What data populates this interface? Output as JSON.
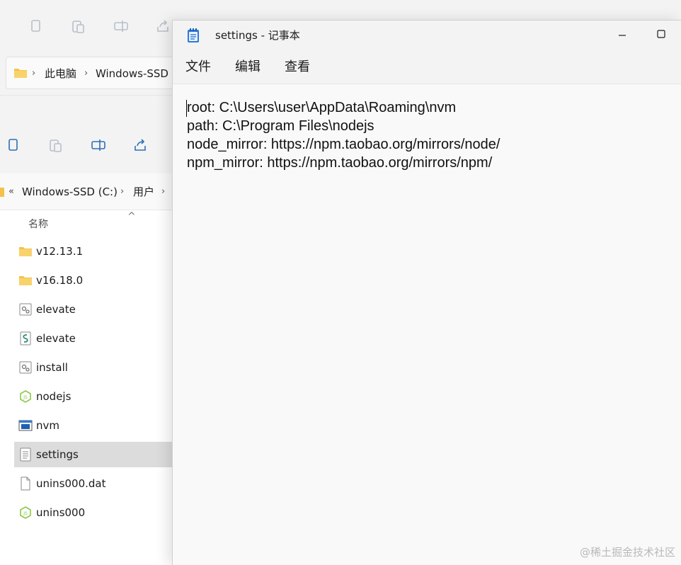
{
  "back_explorer": {
    "breadcrumb": [
      "此电脑",
      "Windows-SSD ("
    ]
  },
  "front_explorer": {
    "breadcrumb_prefix": "«",
    "breadcrumb": [
      "Windows-SSD (C:)",
      "用户"
    ],
    "column_header": "名称",
    "files": [
      {
        "name": "v12.13.1",
        "icon": "folder-icon",
        "selected": false
      },
      {
        "name": "v16.18.0",
        "icon": "folder-icon",
        "selected": false
      },
      {
        "name": "elevate",
        "icon": "cmd-file-icon",
        "selected": false
      },
      {
        "name": "elevate",
        "icon": "script-file-icon",
        "selected": false
      },
      {
        "name": "install",
        "icon": "cmd-file-icon",
        "selected": false
      },
      {
        "name": "nodejs",
        "icon": "nodejs-icon",
        "selected": false
      },
      {
        "name": "nvm",
        "icon": "exe-icon",
        "selected": false
      },
      {
        "name": "settings",
        "icon": "text-file-icon",
        "selected": true
      },
      {
        "name": "unins000.dat",
        "icon": "blank-file-icon",
        "selected": false
      },
      {
        "name": "unins000",
        "icon": "nodejs-icon",
        "selected": false
      }
    ]
  },
  "notepad": {
    "title": "settings - 记事本",
    "menu": [
      "文件",
      "编辑",
      "查看"
    ],
    "lines": [
      "root: C:\\Users\\user\\AppData\\Roaming\\nvm",
      "path: C:\\Program Files\\nodejs",
      "node_mirror: https://npm.taobao.org/mirrors/node/",
      "npm_mirror: https://npm.taobao.org/mirrors/npm/"
    ]
  },
  "watermark": "@稀土掘金技术社区",
  "colors": {
    "folder": "#f4c24a",
    "nodejs_green": "#8cc84b",
    "notepad_blue": "#2f7ad8",
    "selected_row": "#dcdcdc"
  }
}
